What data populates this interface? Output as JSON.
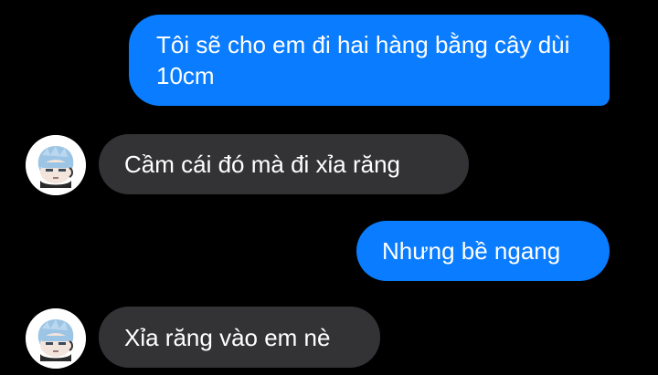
{
  "conversation": {
    "messages": [
      {
        "direction": "outgoing",
        "text": "Tôi sẽ cho em đi hai hàng bằng cây dùi 10cm"
      },
      {
        "direction": "incoming",
        "text": "Cầm cái đó mà đi xỉa răng",
        "avatar": "chibi-avatar-icon"
      },
      {
        "direction": "outgoing",
        "text": "Nhưng bề ngang"
      },
      {
        "direction": "incoming",
        "text": "Xỉa răng vào em nè",
        "avatar": "chibi-avatar-icon"
      }
    ]
  },
  "colors": {
    "background": "#000000",
    "outgoing_bubble": "#0a7cff",
    "incoming_bubble": "#333336",
    "text": "#ffffff"
  }
}
